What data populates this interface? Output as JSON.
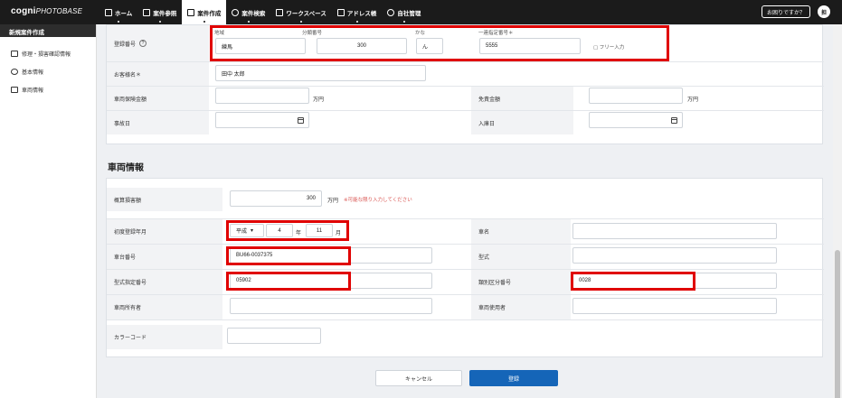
{
  "app": {
    "logo_main": "cogni",
    "logo_sub": "PHOTOBASE"
  },
  "nav": [
    {
      "label": "ホーム",
      "icon": "grid-icon"
    },
    {
      "label": "案件参照",
      "icon": "document-icon"
    },
    {
      "label": "案件作成",
      "icon": "image-plus-icon"
    },
    {
      "label": "案件検索",
      "icon": "search-icon"
    },
    {
      "label": "ワークスペース",
      "icon": "workspace-icon"
    },
    {
      "label": "アドレス帳",
      "icon": "address-book-icon"
    },
    {
      "label": "自社管理",
      "icon": "gear-icon"
    }
  ],
  "header": {
    "help_label": "お困りですか？",
    "avatar_text": "担"
  },
  "sidebar": {
    "title": "新規案件作成",
    "items": [
      {
        "label": "修理・損害確認情報"
      },
      {
        "label": "基本情報"
      },
      {
        "label": "車両情報"
      }
    ]
  },
  "basic": {
    "reg_label": "登録番号",
    "region_label": "地域",
    "region_value": "練馬",
    "class_label": "分類番号",
    "class_value": "300",
    "kana_label": "かな",
    "kana_value": "ん",
    "serial_label": "一連指定番号＊",
    "serial_value": "5555",
    "free_input_label": "フリー入力",
    "customer_label": "お客様名＊",
    "customer_value": "田中 太郎",
    "insurance_label": "車両保険金額",
    "insurance_unit": "万円",
    "deductible_label": "免責金額",
    "deductible_unit": "万円",
    "accident_label": "事故日",
    "entry_label": "入庫日"
  },
  "vehicle": {
    "section_title": "車両情報",
    "estimate_label": "概算損害額",
    "estimate_value": "300",
    "estimate_unit": "万円",
    "estimate_note": "※可能な限り入力してください",
    "first_reg_label": "初度登録年月",
    "era_value": "平成",
    "year_value": "4",
    "year_unit": "年",
    "month_value": "11",
    "month_unit": "月",
    "car_name_label": "車名",
    "chassis_label": "車台番号",
    "chassis_value": "BU66-0037375",
    "model_label": "型式",
    "model_designation_label": "型式指定番号",
    "model_designation_value": "05902",
    "category_label": "類別区分番号",
    "category_value": "0028",
    "owner_label": "車両所有者",
    "user_label": "車両使用者",
    "color_label": "カラーコード"
  },
  "buttons": {
    "cancel": "キャンセル",
    "submit": "登録"
  },
  "colors": {
    "highlight": "#e00000",
    "primary": "#1565b8",
    "topbar": "#1b1b1b"
  }
}
